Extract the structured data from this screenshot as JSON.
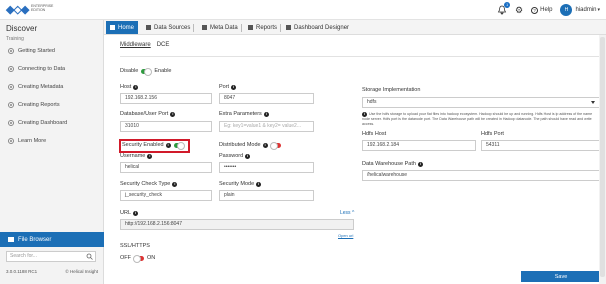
{
  "header": {
    "logo_text": "ENTERPRISE EDITION",
    "notif_count": "1",
    "help_label": "Help",
    "avatar_initials": "H",
    "user_label": "hiadmin"
  },
  "sidebar": {
    "title": "Discover",
    "subtitle": "Training",
    "items": [
      {
        "label": "Getting Started"
      },
      {
        "label": "Connecting to Data"
      },
      {
        "label": "Creating Metadata"
      },
      {
        "label": "Creating Reports"
      },
      {
        "label": "Creating Dashboard"
      },
      {
        "label": "Learn More"
      }
    ],
    "file_browser_label": "File Browser",
    "search_placeholder": "Search for...",
    "version": "3.0.0.1188 RC1",
    "copyright": "© Helical Insight"
  },
  "tabs": [
    {
      "label": "Home"
    },
    {
      "label": "Data Sources"
    },
    {
      "label": "Meta Data"
    },
    {
      "label": "Reports"
    },
    {
      "label": "Dashboard Designer"
    }
  ],
  "form": {
    "subtabs": [
      "Middleware",
      "DCE"
    ],
    "disable_label": "Disable",
    "enable_label": "Enable",
    "host_label": "Host",
    "host_value": "192.168.2.156",
    "port_label": "Port",
    "port_value": "8047",
    "db_port_label": "Database/User Port",
    "db_port_value": "31010",
    "extra_label": "Extra Parameters",
    "extra_placeholder": "Eg: key1=value1 & key2= value2...",
    "security_enabled_label": "Security Enabled",
    "distributed_mode_label": "Distributed Mode",
    "username_label": "Username",
    "username_value": "helical",
    "password_label": "Password",
    "password_value": "•••••••",
    "check_type_label": "Security Check Type",
    "check_type_value": "j_security_check",
    "security_mode_label": "Security Mode",
    "security_mode_value": "plain",
    "url_label": "URL",
    "url_value": "http://192.168.2.156:8047",
    "less_link": "Less ^",
    "open_url_link": "Open url",
    "ssl_label": "SSL/HTTPS",
    "off_label": "OFF",
    "on_label": "ON",
    "storage_label": "Storage Implementation",
    "storage_value": "hdfs",
    "storage_note": "Use the hdfs storage to upload your flat files into hadoop ecosystem. Hadoop should be up and running. Hdfs Host is ip address of the name node server. Hdfs port is the datanode port. The Data Warehouse path will be created in Hadoop datanode. The path should have read and write access.",
    "hdfs_host_label": "Hdfs Host",
    "hdfs_host_value": "192.168.2.184",
    "hdfs_port_label": "Hdfs Port",
    "hdfs_port_value": "54311",
    "dw_path_label": "Data Warehouse Path",
    "dw_path_value": "/helicalwarehouse",
    "save_label": "Save"
  }
}
